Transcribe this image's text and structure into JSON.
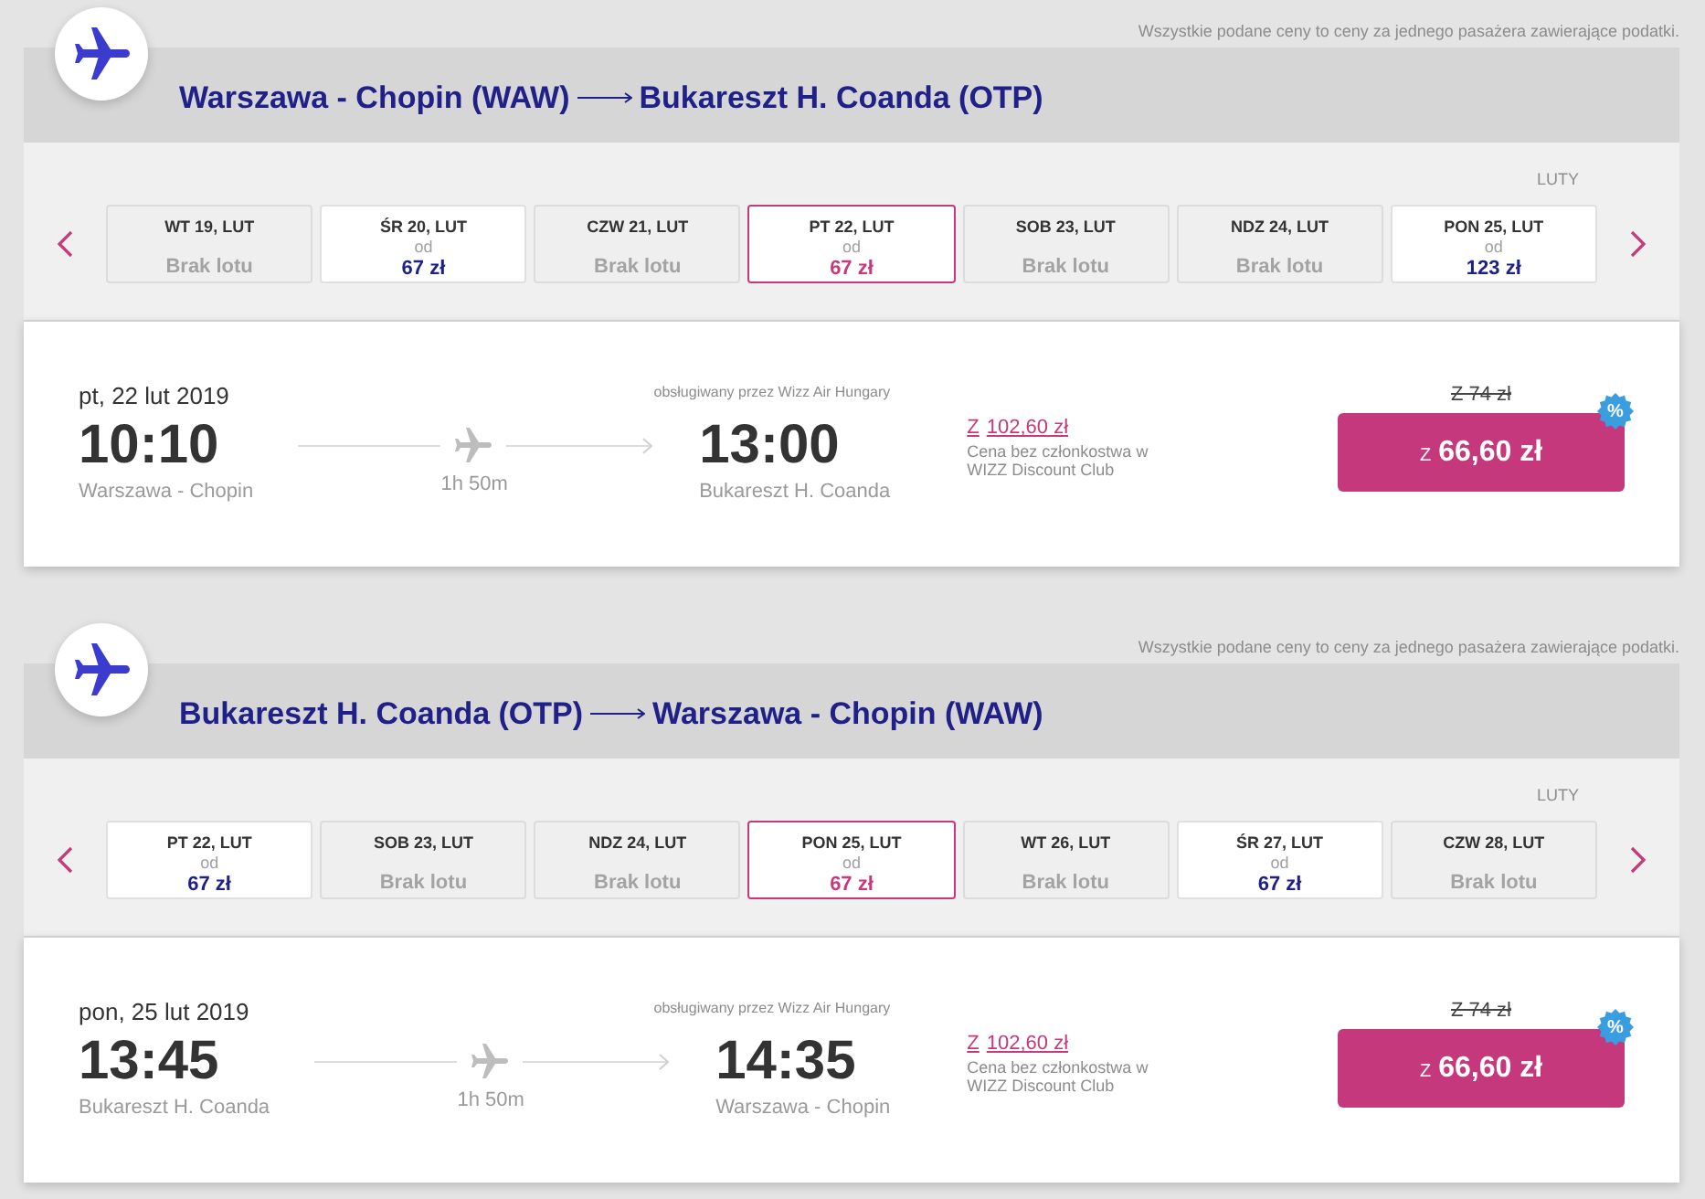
{
  "journeys": [
    {
      "price_note": "Wszystkie podane ceny to ceny za jednego pasażera zawierające podatki.",
      "origin": "Warszawa - Chopin (WAW)",
      "destination": "Bukareszt H. Coanda (OTP)",
      "month": "LUTY",
      "dates": [
        {
          "kind": "no_flight",
          "label": "WT 19, LUT",
          "status": "Brak lotu",
          "selected": false
        },
        {
          "kind": "fare",
          "label": "ŚR 20, LUT",
          "from": "od",
          "price": "67 zł",
          "selected": false
        },
        {
          "kind": "no_flight",
          "label": "CZW 21, LUT",
          "status": "Brak lotu",
          "selected": false
        },
        {
          "kind": "fare",
          "label": "PT 22, LUT",
          "from": "od",
          "price": "67 zł",
          "selected": true
        },
        {
          "kind": "no_flight",
          "label": "SOB 23, LUT",
          "status": "Brak lotu",
          "selected": false
        },
        {
          "kind": "no_flight",
          "label": "NDZ 24, LUT",
          "status": "Brak lotu",
          "selected": false
        },
        {
          "kind": "fare",
          "label": "PON 25, LUT",
          "from": "od",
          "price": "123 zł",
          "selected": false
        }
      ],
      "flight": {
        "date": "pt, 22 lut 2019",
        "departure_time": "10:10",
        "departure_airport": "Warszawa - Chopin",
        "duration": "1h 50m",
        "operator": "obsługiwany przez Wizz Air Hungary",
        "arrival_time": "13:00",
        "arrival_airport": "Bukareszt H. Coanda",
        "regular_price_prefix": "Z",
        "regular_price": "102,60 zł",
        "regular_price_note": "Cena bez członkostwa w WIZZ Discount Club",
        "old_price": "Z 74 zł",
        "price_prefix": "Z",
        "price": "66,60 zł",
        "discount_badge": "%"
      }
    },
    {
      "price_note": "Wszystkie podane ceny to ceny za jednego pasażera zawierające podatki.",
      "origin": "Bukareszt H. Coanda (OTP)",
      "destination": "Warszawa - Chopin (WAW)",
      "month": "LUTY",
      "dates": [
        {
          "kind": "fare",
          "label": "PT 22, LUT",
          "from": "od",
          "price": "67 zł",
          "selected": false
        },
        {
          "kind": "no_flight",
          "label": "SOB 23, LUT",
          "status": "Brak lotu",
          "selected": false
        },
        {
          "kind": "no_flight",
          "label": "NDZ 24, LUT",
          "status": "Brak lotu",
          "selected": false
        },
        {
          "kind": "fare",
          "label": "PON 25, LUT",
          "from": "od",
          "price": "67 zł",
          "selected": true
        },
        {
          "kind": "no_flight",
          "label": "WT 26, LUT",
          "status": "Brak lotu",
          "selected": false
        },
        {
          "kind": "fare",
          "label": "ŚR 27, LUT",
          "from": "od",
          "price": "67 zł",
          "selected": false
        },
        {
          "kind": "no_flight",
          "label": "CZW 28, LUT",
          "status": "Brak lotu",
          "selected": false
        }
      ],
      "flight": {
        "date": "pon, 25 lut 2019",
        "departure_time": "13:45",
        "departure_airport": "Bukareszt H. Coanda",
        "duration": "1h 50m",
        "operator": "obsługiwany przez Wizz Air Hungary",
        "arrival_time": "14:35",
        "arrival_airport": "Warszawa - Chopin",
        "regular_price_prefix": "Z",
        "regular_price": "102,60 zł",
        "regular_price_note": "Cena bez członkostwa w WIZZ Discount Club",
        "old_price": "Z 74 zł",
        "price_prefix": "Z",
        "price": "66,60 zł",
        "discount_badge": "%"
      }
    }
  ]
}
